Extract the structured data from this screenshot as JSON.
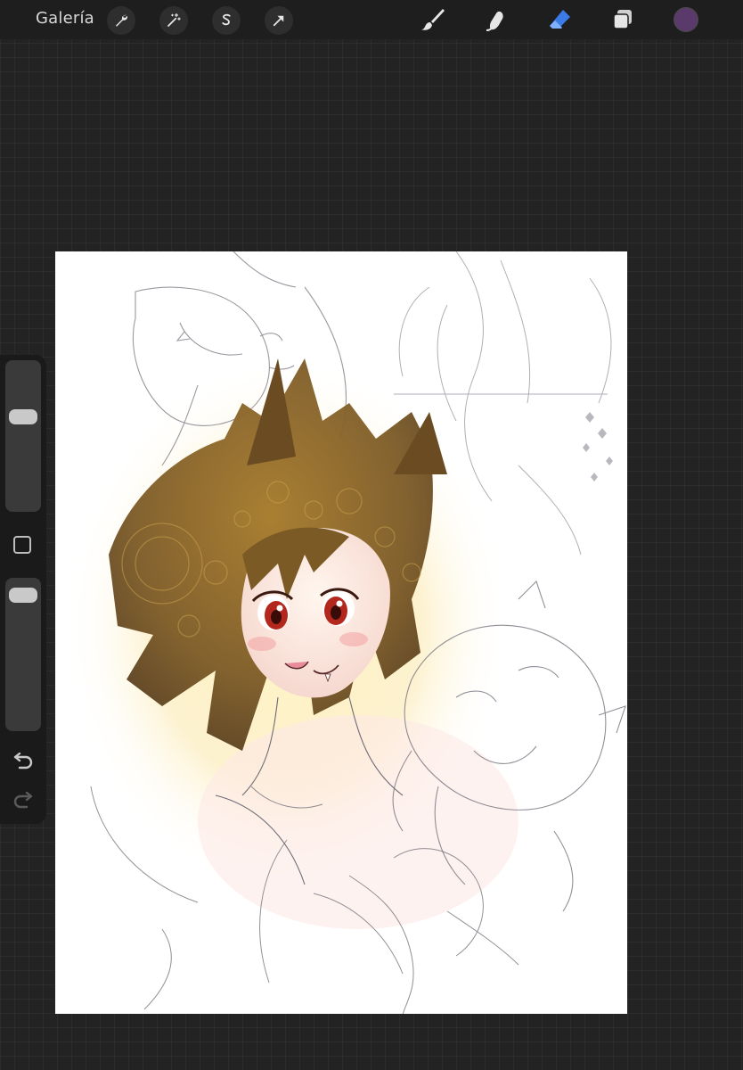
{
  "topbar": {
    "gallery_label": "Galería",
    "actions": [
      {
        "name": "actions-wrench",
        "icon": "wrench-icon"
      },
      {
        "name": "adjustments",
        "icon": "magic-wand-icon"
      },
      {
        "name": "selection",
        "icon": "selection-s-icon"
      },
      {
        "name": "transform",
        "icon": "arrow-cursor-icon"
      }
    ],
    "tools": [
      {
        "name": "brush",
        "icon": "brush-icon",
        "active": false
      },
      {
        "name": "smudge",
        "icon": "smudge-icon",
        "active": false
      },
      {
        "name": "eraser",
        "icon": "eraser-icon",
        "active": true
      },
      {
        "name": "layers",
        "icon": "layers-icon",
        "active": false
      }
    ],
    "current_color": "#5a3a6b",
    "active_tool_color": "#3a7be8"
  },
  "sidebar": {
    "brush_size_level": 0.35,
    "opacity_level": 0.05,
    "icons": [
      "modify-square-icon",
      "undo-icon",
      "redo-icon"
    ]
  },
  "canvas": {
    "background": "#ffffff",
    "artwork": "sketch-illustration"
  }
}
